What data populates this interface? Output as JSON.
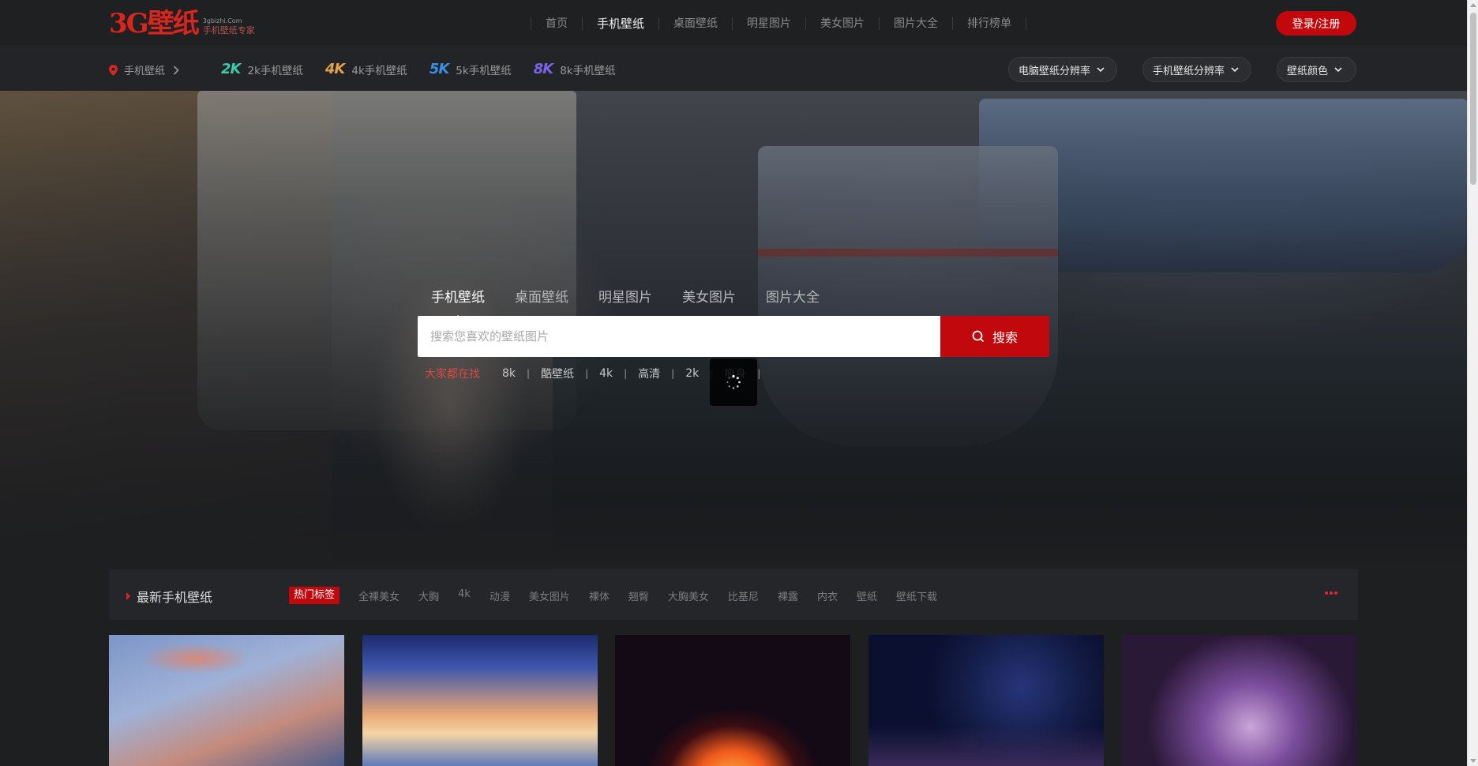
{
  "header": {
    "logo_mark": "3G壁纸",
    "logo_domain": "3gbizhi.Com",
    "logo_tagline": "手机壁纸专家",
    "nav": [
      {
        "label": "首页",
        "active": false
      },
      {
        "label": "手机壁纸",
        "active": true
      },
      {
        "label": "桌面壁纸",
        "active": false
      },
      {
        "label": "明星图片",
        "active": false
      },
      {
        "label": "美女图片",
        "active": false
      },
      {
        "label": "图片大全",
        "active": false
      },
      {
        "label": "排行榜单",
        "active": false
      }
    ],
    "login_label": "登录/注册"
  },
  "subbar": {
    "breadcrumb": "手机壁纸",
    "resolutions": [
      {
        "badge": "2K",
        "label": "2k手机壁纸"
      },
      {
        "badge": "4K",
        "label": "4k手机壁纸"
      },
      {
        "badge": "5K",
        "label": "5k手机壁纸"
      },
      {
        "badge": "8K",
        "label": "8k手机壁纸"
      }
    ],
    "dropdowns": {
      "pc_resolution": "电脑壁纸分辨率",
      "phone_resolution": "手机壁纸分辨率",
      "color": "壁纸颜色"
    }
  },
  "hero": {
    "tabs": [
      {
        "label": "手机壁纸",
        "active": true
      },
      {
        "label": "桌面壁纸",
        "active": false
      },
      {
        "label": "明星图片",
        "active": false
      },
      {
        "label": "美女图片",
        "active": false
      },
      {
        "label": "图片大全",
        "active": false
      }
    ],
    "search": {
      "placeholder": "搜索您喜欢的壁纸图片",
      "value": "",
      "button_label": "搜索"
    },
    "hot_lead": "大家都在找",
    "hot_keywords": [
      "8k",
      "酷壁纸",
      "4k",
      "高清",
      "2k",
      "瘦身"
    ]
  },
  "section": {
    "title": "最新手机壁纸",
    "hot_badge": "热门标签",
    "tags": [
      "全裸美女",
      "大胸",
      "4k",
      "动漫",
      "美女图片",
      "裸体",
      "翘臀",
      "大胸美女",
      "比基尼",
      "裸露",
      "内衣",
      "壁纸",
      "壁纸下载"
    ]
  },
  "colors": {
    "accent": "#c1080c",
    "background": "#1e1f21"
  }
}
